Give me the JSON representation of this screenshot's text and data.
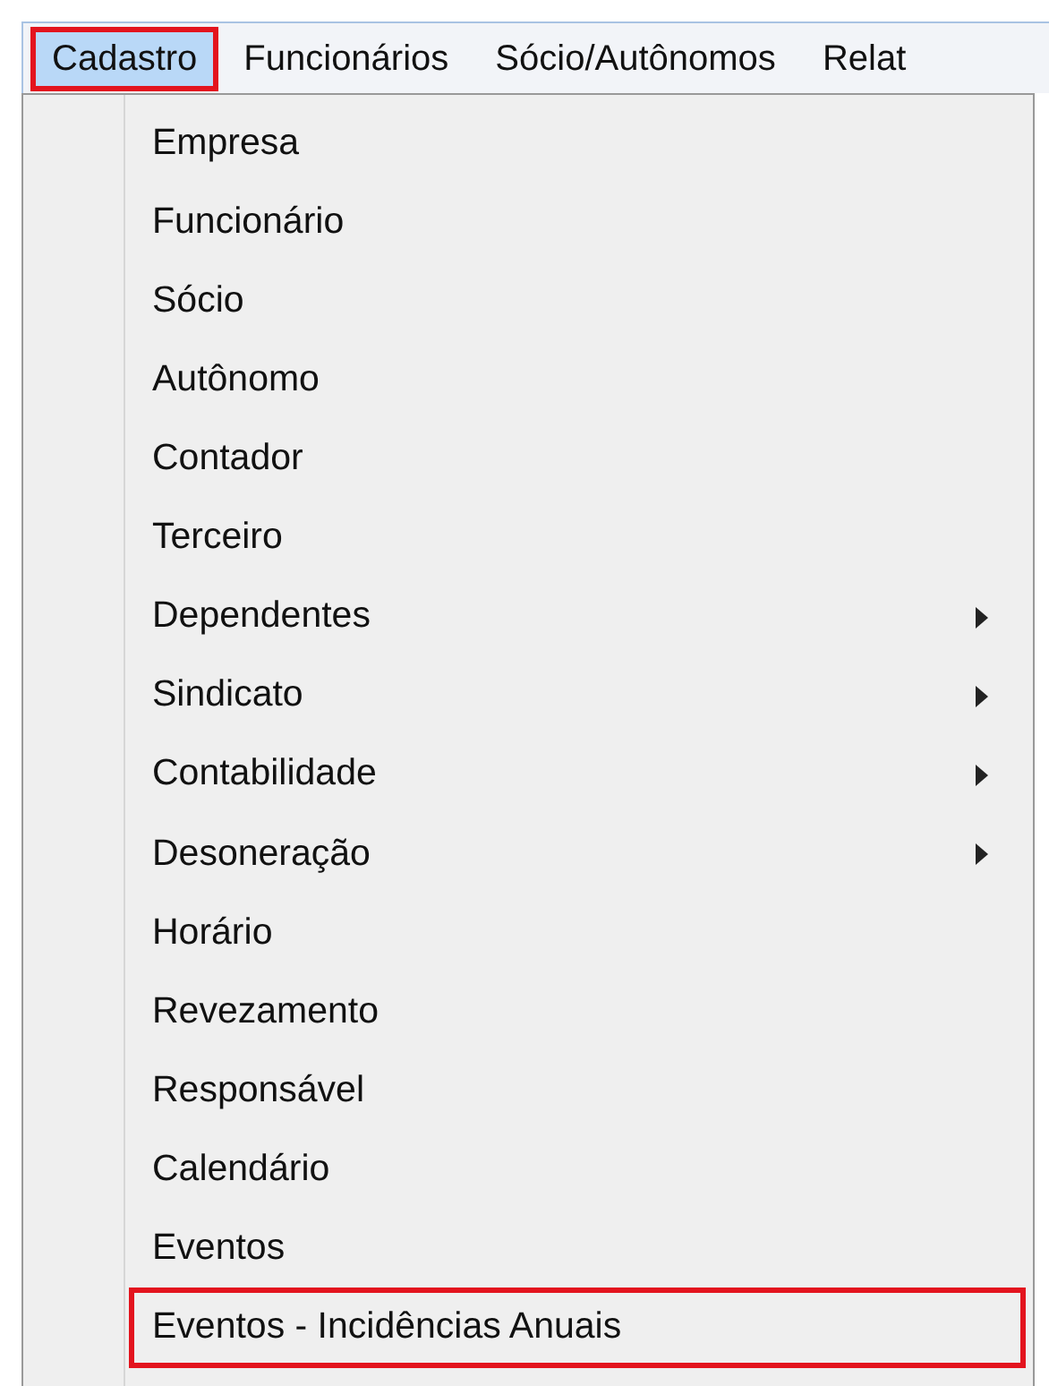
{
  "menubar": [
    {
      "label": "Cadastro",
      "selected": true,
      "highlighted": true
    },
    {
      "label": "Funcionários",
      "selected": false,
      "highlighted": false
    },
    {
      "label": "Sócio/Autônomos",
      "selected": false,
      "highlighted": false
    },
    {
      "label": "Relat",
      "selected": false,
      "highlighted": false
    }
  ],
  "menu_items": [
    {
      "label": "Empresa",
      "submenu": false,
      "highlighted": false
    },
    {
      "label": "Funcionário",
      "submenu": false,
      "highlighted": false
    },
    {
      "label": "Sócio",
      "submenu": false,
      "highlighted": false
    },
    {
      "label": "Autônomo",
      "submenu": false,
      "highlighted": false
    },
    {
      "label": "Contador",
      "submenu": false,
      "highlighted": false
    },
    {
      "label": "Terceiro",
      "submenu": false,
      "highlighted": false
    },
    {
      "label": "Dependentes",
      "submenu": true,
      "highlighted": false
    },
    {
      "label": "Sindicato",
      "submenu": true,
      "highlighted": false
    },
    {
      "label": "Contabilidade",
      "submenu": true,
      "highlighted": false
    },
    {
      "label": "Desoneração",
      "submenu": true,
      "highlighted": false
    },
    {
      "label": "Horário",
      "submenu": false,
      "highlighted": false
    },
    {
      "label": "Revezamento",
      "submenu": false,
      "highlighted": false
    },
    {
      "label": "Responsável",
      "submenu": false,
      "highlighted": false
    },
    {
      "label": "Calendário",
      "submenu": false,
      "highlighted": false
    },
    {
      "label": "Eventos",
      "submenu": false,
      "highlighted": false
    },
    {
      "label": "Eventos - Incidências Anuais",
      "submenu": false,
      "highlighted": true
    }
  ]
}
